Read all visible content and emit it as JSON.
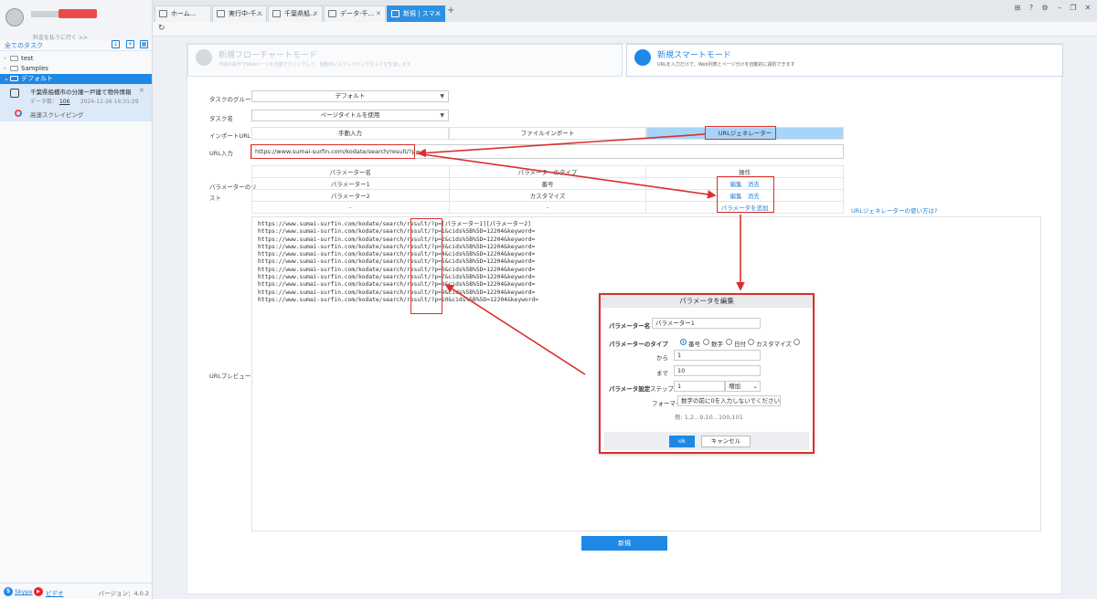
{
  "sidebar": {
    "pay_link": "料金を払うに行く >>",
    "all_tasks": "全てのタスク",
    "tree": [
      {
        "label": "test"
      },
      {
        "label": "Samples"
      },
      {
        "label": "デフォルト"
      }
    ],
    "task": {
      "title": "千葉県船橋市の分譲一戸建て物件情報（賃...",
      "data_label": "データ数：",
      "data_count": "106",
      "date": "2024-11-26 16:31:29",
      "mode": "高速スクレイピング"
    },
    "footer": {
      "skype": "Skype",
      "video": "ビデオ",
      "version": "バージョン：4.0.2"
    }
  },
  "tabs": [
    {
      "label": "ホーム..."
    },
    {
      "label": "実行中-千..."
    },
    {
      "label": "千葉県船..."
    },
    {
      "label": "データ-千..."
    },
    {
      "label": "新規 | スマ..."
    }
  ],
  "modes": {
    "flow": {
      "title": "新規フローチャートモード",
      "desc": "作成の操作でWebページを自動でクリックして、自動的にスクレイピングタスクを生成します"
    },
    "smart": {
      "title": "新規スマートモード",
      "desc": "URLを入力だけで、Web列表とページ分けを自動的に識別できます"
    }
  },
  "form": {
    "group_label": "タスクのグループ",
    "group_value": "デフォルト",
    "name_label": "タスク名",
    "name_value": "ページタイトルを使用",
    "import_label": "インポートURL",
    "import_tabs": [
      "手動入力",
      "ファイルインポート",
      "URLジェネレーター"
    ],
    "url_label": "URL入力",
    "url_value": "https://www.sumai-surfin.com/kodate/search/result/?p=",
    "params_label_1": "パラメーターのリ",
    "params_label_2": "スト",
    "table_headers": [
      "パラメーター名",
      "パラメーターのタイプ",
      "操作"
    ],
    "table_rows": [
      {
        "name": "パラメーター1",
        "type": "番号",
        "edit": "編集",
        "delete": "消去"
      },
      {
        "name": "パラメーター2",
        "type": "カスタマイズ",
        "edit": "編集",
        "delete": "消去"
      }
    ],
    "empty_cell": "-",
    "add_param": "パラメータを追加",
    "help_link": "URLジェネレーターの使い方は?",
    "preview_label": "URLプレビュー",
    "preview_lines": [
      "https://www.sumai-surfin.com/kodate/search/result/?p=[パラメーター1][パラメーター2]",
      "https://www.sumai-surfin.com/kodate/search/result/?p=1&cids%5B%5D=12204&keyword=",
      "https://www.sumai-surfin.com/kodate/search/result/?p=2&cids%5B%5D=12204&keyword=",
      "https://www.sumai-surfin.com/kodate/search/result/?p=3&cids%5B%5D=12204&keyword=",
      "https://www.sumai-surfin.com/kodate/search/result/?p=4&cids%5B%5D=12204&keyword=",
      "https://www.sumai-surfin.com/kodate/search/result/?p=5&cids%5B%5D=12204&keyword=",
      "https://www.sumai-surfin.com/kodate/search/result/?p=6&cids%5B%5D=12204&keyword=",
      "https://www.sumai-surfin.com/kodate/search/result/?p=7&cids%5B%5D=12204&keyword=",
      "https://www.sumai-surfin.com/kodate/search/result/?p=8&cids%5B%5D=12204&keyword=",
      "https://www.sumai-surfin.com/kodate/search/result/?p=9&cids%5B%5D=12204&keyword=",
      "https://www.sumai-surfin.com/kodate/search/result/?p=10&cids%5B%5D=12204&keyword="
    ],
    "create_button": "新規"
  },
  "dialog": {
    "title": "パラメータを編集",
    "name_label": "パラメーター名",
    "name_value": "パラメーター1",
    "type_label": "パラメーターのタイプ",
    "type_options": [
      "番号",
      "数字",
      "日付",
      "カスタマイズ"
    ],
    "type_selected": "番号",
    "from_label": "から",
    "from_value": "1",
    "to_label": "まで",
    "to_value": "10",
    "setting_label": "パラメータ設定",
    "step_label": "ステップ",
    "step_value": "1",
    "step_mode": "増加",
    "format_label": "フォーマット",
    "format_value": "数字の前に0を入力しないでください",
    "example": "例: 1,2...9,10...100,101",
    "ok": "ok",
    "cancel": "キャンセル"
  },
  "colors": {
    "accent": "#1e88e5",
    "annotation": "#d9302c"
  }
}
